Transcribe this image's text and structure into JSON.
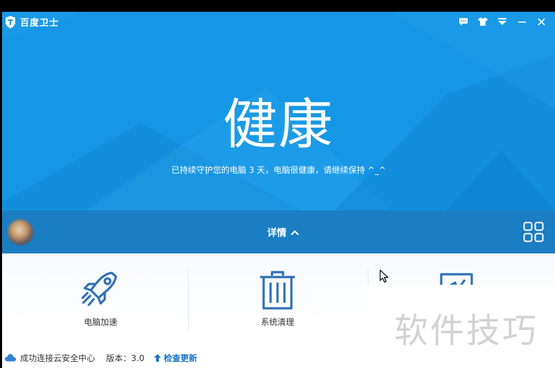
{
  "app": {
    "title": "百度卫士"
  },
  "status": {
    "title": "健康",
    "subtitle": "已持续守护您的电脑 3 天，电脑很健康，请继续保持 ^_^"
  },
  "details": {
    "label": "详情"
  },
  "tools": [
    {
      "label": "电脑加速",
      "icon": "rocket-icon"
    },
    {
      "label": "系统清理",
      "icon": "trash-icon"
    },
    {
      "label": "",
      "icon": "shield-icon"
    }
  ],
  "footer": {
    "connection": "成功连接云安全中心",
    "version": "版本：3.0",
    "update": "检查更新"
  },
  "watermark": {
    "text": "软件技巧"
  },
  "colors": {
    "primary": "#1597e5",
    "bar": "#1b7dc2",
    "icon": "#2f6fb4"
  }
}
